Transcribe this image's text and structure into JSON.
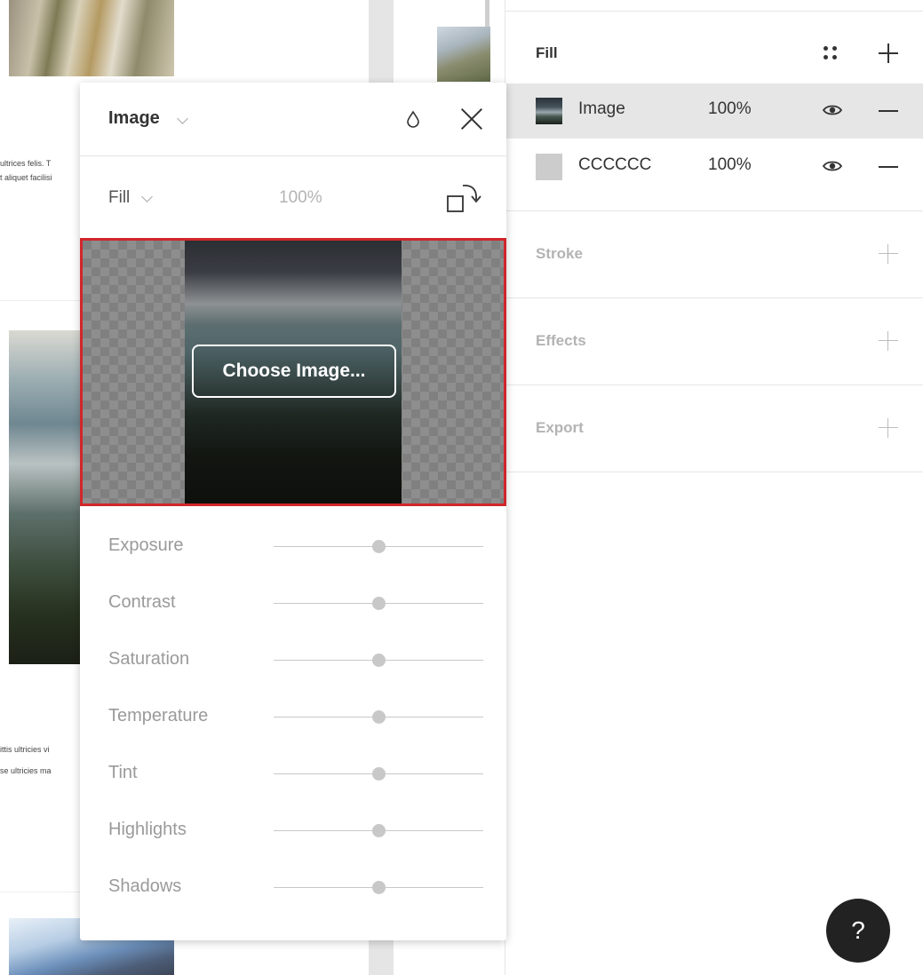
{
  "canvas": {
    "snippets": [
      {
        "text": "ultrices felis. T"
      },
      {
        "text": "t aliquet facilisi"
      },
      {
        "text": "ittis ultricies vi"
      },
      {
        "text": "se ultricies ma"
      }
    ]
  },
  "popover": {
    "type_label": "Image",
    "mode_label": "Fill",
    "opacity": "100%",
    "choose_button": "Choose Image...",
    "adjustments": [
      {
        "label": "Exposure",
        "value": 0.5
      },
      {
        "label": "Contrast",
        "value": 0.5
      },
      {
        "label": "Saturation",
        "value": 0.5
      },
      {
        "label": "Temperature",
        "value": 0.5
      },
      {
        "label": "Tint",
        "value": 0.5
      },
      {
        "label": "Highlights",
        "value": 0.5
      },
      {
        "label": "Shadows",
        "value": 0.5
      }
    ]
  },
  "panel": {
    "fill": {
      "title": "Fill",
      "rows": [
        {
          "name": "Image",
          "opacity": "100%",
          "swatch": "image",
          "selected": true
        },
        {
          "name": "CCCCCC",
          "opacity": "100%",
          "swatch": "#CCCCCC",
          "selected": false
        }
      ]
    },
    "stroke": {
      "title": "Stroke"
    },
    "effects": {
      "title": "Effects"
    },
    "export": {
      "title": "Export"
    }
  },
  "help": {
    "label": "?"
  },
  "colors": {
    "selection_border": "#d1262a",
    "help_button_bg": "#222222",
    "selected_row_bg": "#e6e6e6"
  }
}
